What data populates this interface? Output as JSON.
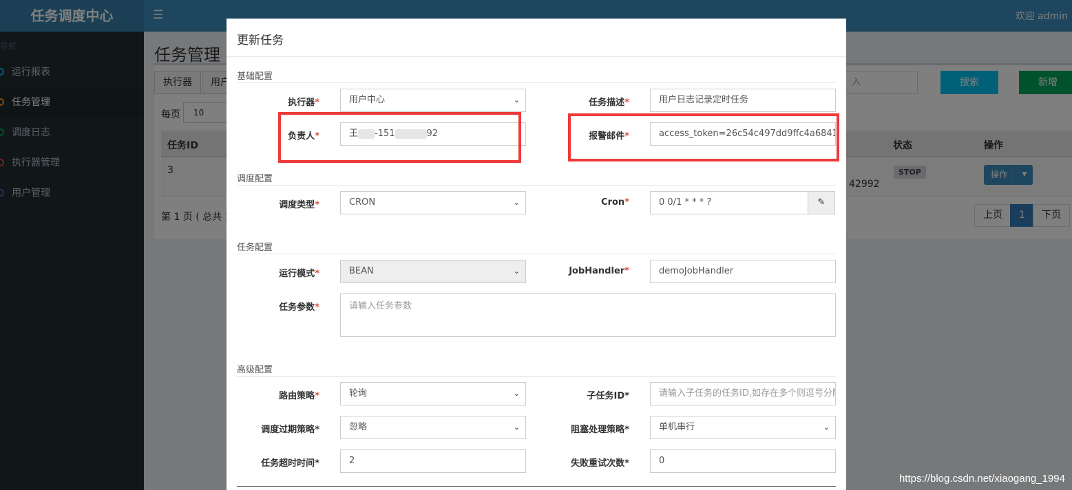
{
  "app": {
    "logo": "任务调度中心",
    "menu_icon": "hamburger-icon",
    "welcome": "欢迎 admin"
  },
  "sidebar": {
    "header": "导航",
    "items": [
      {
        "label": "运行报表",
        "color": "#00c0ef",
        "active": false
      },
      {
        "label": "任务管理",
        "color": "#f39c12",
        "active": true
      },
      {
        "label": "调度日志",
        "color": "#00a65a",
        "active": false
      },
      {
        "label": "执行器管理",
        "color": "#dd4b39",
        "active": false
      },
      {
        "label": "用户管理",
        "color": "#605ca8",
        "active": false
      }
    ]
  },
  "content": {
    "title": "任务管理",
    "filter_tabs": [
      "执行器",
      "用户"
    ],
    "search_placeholder": "入",
    "search_button": "搜索",
    "add_button": "新增",
    "per_page_label": "每页",
    "per_page_value": "10",
    "table": {
      "headers": {
        "id": "任务ID",
        "status": "状态",
        "action": "操作"
      },
      "row": {
        "id": "3",
        "partial": "42992",
        "status": "STOP",
        "action": "操作"
      }
    },
    "page_info": "第 1 页 ( 总共 1",
    "pagination": {
      "prev": "上页",
      "current": "1",
      "next": "下页"
    }
  },
  "modal": {
    "title": "更新任务",
    "sections": {
      "basic": "基础配置",
      "schedule": "调度配置",
      "task": "任务配置",
      "advanced": "高级配置"
    },
    "fields": {
      "executor": {
        "label": "执行器",
        "value": "用户中心"
      },
      "desc": {
        "label": "任务描述",
        "value": "用户日志记录定时任务"
      },
      "owner": {
        "label": "负责人",
        "value_start": "王",
        "value_mid": "-151",
        "value_end": "92"
      },
      "alarm": {
        "label": "报警邮件",
        "value": "access_token=26c54c497dd9ffc4a6841"
      },
      "schedule_type": {
        "label": "调度类型",
        "value": "CRON"
      },
      "cron": {
        "label": "Cron",
        "value": "0 0/1 * * * ?",
        "icon": "edit-icon"
      },
      "run_mode": {
        "label": "运行模式",
        "value": "BEAN"
      },
      "job_handler": {
        "label": "JobHandler",
        "value": "demoJobHandler"
      },
      "params": {
        "label": "任务参数",
        "placeholder": "请输入任务参数"
      },
      "route": {
        "label": "路由策略",
        "value": "轮询"
      },
      "child_id": {
        "label": "子任务ID",
        "placeholder": "请输入子任务的任务ID,如存在多个则逗号分隔"
      },
      "misfire": {
        "label": "调度过期策略",
        "value": "忽略"
      },
      "block": {
        "label": "阻塞处理策略",
        "value": "单机串行"
      },
      "timeout": {
        "label": "任务超时时间",
        "value": "2"
      },
      "retry": {
        "label": "失败重试次数",
        "value": "0"
      }
    },
    "required_mark": "*",
    "highlight_color": "#ef3a3a"
  },
  "watermark": "https://blog.csdn.net/xiaogang_1994"
}
